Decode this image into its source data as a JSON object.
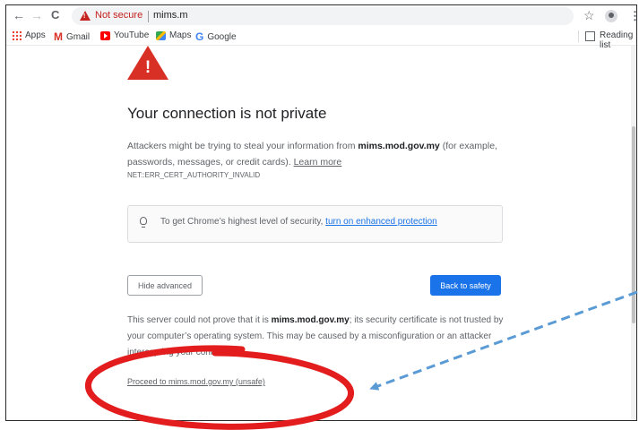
{
  "browser": {
    "back_glyph": "←",
    "forward_glyph": "→",
    "reload_glyph": "C",
    "security_label": "Not secure",
    "url": "mims.m",
    "bookmark_glyph": "☆",
    "menu_glyph": "⋮"
  },
  "bookmarks": {
    "items": [
      {
        "label": "Apps",
        "icon": "apps-grid-icon"
      },
      {
        "label": "Gmail",
        "icon": "gmail-icon",
        "glyph": "M"
      },
      {
        "label": "YouTube",
        "icon": "youtube-icon"
      },
      {
        "label": "Maps",
        "icon": "maps-icon"
      },
      {
        "label": "Google",
        "icon": "google-icon",
        "glyph": "G"
      }
    ],
    "reading_list": "Reading list"
  },
  "interstitial": {
    "heading": "Your connection is not private",
    "warning_glyph": "!",
    "message_prefix": "Attackers might be trying to steal your information from ",
    "domain": "mims.mod.gov.my",
    "message_suffix": " (for example, passwords, messages, or credit cards). ",
    "learn_more": "Learn more",
    "error_code": "NET::ERR_CERT_AUTHORITY_INVALID",
    "enhanced_text": "To get Chrome’s highest level of security, ",
    "enhanced_link": "turn on enhanced protection",
    "hide_advanced": "Hide advanced",
    "back_to_safety": "Back to safety",
    "advanced_prefix": "This server could not prove that it is ",
    "advanced_domain": "mims.mod.gov.my",
    "advanced_suffix": "; its security certificate is not trusted by your computer’s operating system. This may be caused by a misconfiguration or an attacker intercepting your connection.",
    "proceed_link": "Proceed to mims.mod.gov.my (unsafe)"
  },
  "colors": {
    "danger": "#d93025",
    "primary": "#1a73e8",
    "annotation_ellipse": "#e31d1d",
    "annotation_arrow": "#5b9bd5"
  }
}
